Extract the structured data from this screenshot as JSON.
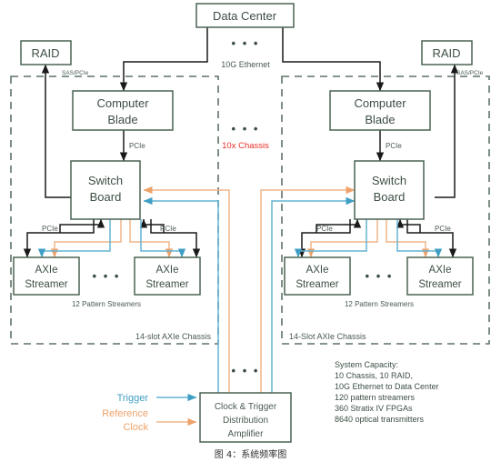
{
  "figure": {
    "caption": "图 4：系统频率图"
  },
  "colors": {
    "box_stroke": "#4a6352",
    "text": "#3d4f44",
    "wire_black": "#1a1a1a",
    "trigger_blue": "#63b3d4",
    "trigger_label_blue": "#3f9ec4",
    "refclock_orange": "#f0b588",
    "refclock_label_orange": "#eda26a",
    "chassis_dash": "#5d7266",
    "accent_red": "#e8312a",
    "background": "#ffffff"
  },
  "nodes": {
    "data_center": "Data Center",
    "raid_left": "RAID",
    "raid_right": "RAID",
    "computer_blade_left_line1": "Computer",
    "computer_blade_left_line2": "Blade",
    "computer_blade_right_line1": "Computer",
    "computer_blade_right_line2": "Blade",
    "switch_board_left_line1": "Switch",
    "switch_board_left_line2": "Board",
    "switch_board_right_line1": "Switch",
    "switch_board_right_line2": "Board",
    "streamer_l1_line1": "AXIe",
    "streamer_l1_line2": "Streamer",
    "streamer_l2_line1": "AXIe",
    "streamer_l2_line2": "Streamer",
    "streamer_r1_line1": "AXIe",
    "streamer_r1_line2": "Streamer",
    "streamer_r2_line1": "AXIe",
    "streamer_r2_line2": "Streamer",
    "amplifier_line1": "Clock & Trigger",
    "amplifier_line2": "Distribution",
    "amplifier_line3": "Amplifier"
  },
  "link_labels": {
    "ethernet": "10G Ethernet",
    "sas_pcie_left": "SAS/PCIe",
    "sas_pcie_right": "SAS/PCIe",
    "pcie_blade_left": "PCIe",
    "pcie_blade_right": "PCIe",
    "pcie_l1": "PCIe",
    "pcie_l2": "PCIe",
    "pcie_r1": "PCIe",
    "pcie_r2": "PCIe"
  },
  "group_labels": {
    "chassis_repeat": "10x Chassis",
    "streamers_left": "12 Pattern Streamers",
    "streamers_right": "12 Pattern Streamers",
    "chassis_left": "14-slot AXIe Chassis",
    "chassis_right": "14-Slot AXIe Chassis"
  },
  "legend": {
    "trigger": "Trigger",
    "reference_clock_line1": "Reference",
    "reference_clock_line2": "Clock"
  },
  "ellipses": {
    "top": "• • •",
    "middle": "• • •",
    "streamers_left": "• • •",
    "streamers_right": "• • •",
    "bottom": "• • •"
  },
  "capacity": {
    "lines": [
      "System Capacity:",
      "10 Chassis, 10 RAID,",
      "10G Ethernet to Data Center",
      "120 pattern streamers",
      "360 Stratix IV FPGAs",
      "8640 optical transmitters"
    ]
  }
}
